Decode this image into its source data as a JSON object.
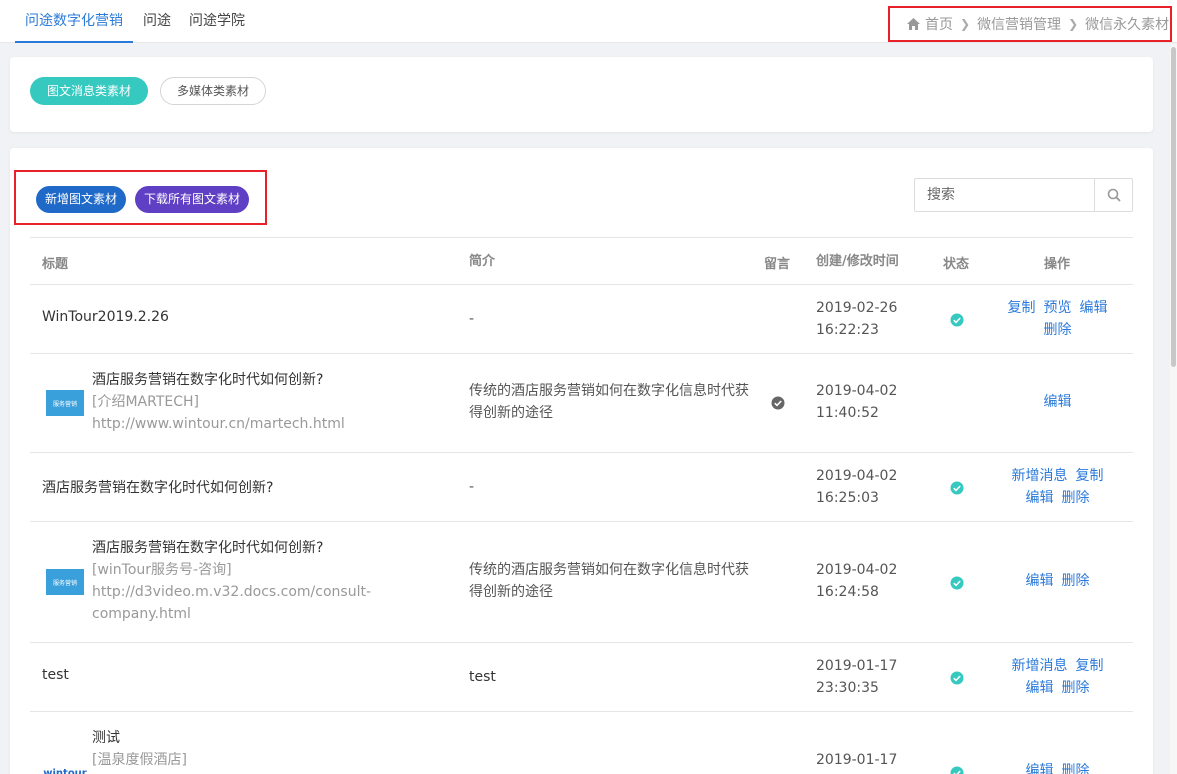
{
  "topnav": {
    "tabs": [
      {
        "label": "问途数字化营销",
        "active": true
      },
      {
        "label": "问途"
      },
      {
        "label": "问途学院"
      }
    ]
  },
  "breadcrumb": {
    "home": "首页",
    "level1": "微信营销管理",
    "level2": "微信永久素材"
  },
  "material_tabs": {
    "news": "图文消息类素材",
    "media": "多媒体类素材"
  },
  "actions": {
    "add": "新增图文素材",
    "download": "下载所有图文素材"
  },
  "search": {
    "placeholder": "搜索"
  },
  "table": {
    "headers": {
      "title": "标题",
      "intro": "简介",
      "comment": "留言",
      "time": "创建/修改时间",
      "status": "状态",
      "ops": "操作"
    },
    "rows": [
      {
        "title": "WinTour2019.2.26",
        "intro": "-",
        "date": "2019-02-26",
        "clock": "16:22:23",
        "ops": [
          "复制",
          "预览",
          "编辑",
          "删除"
        ]
      },
      {
        "title": "酒店服务营销在数字化时代如何创新?",
        "source": "[介绍MARTECH]",
        "link": "http://www.wintour.cn/martech.html",
        "thumb": "服务营销",
        "intro": "传统的酒店服务营销如何在数字化信息时代获得创新的途径",
        "date": "2019-04-02",
        "clock": "11:40:52",
        "ops": [
          "编辑"
        ]
      },
      {
        "title": "酒店服务营销在数字化时代如何创新?",
        "intro": "-",
        "date": "2019-04-02",
        "clock": "16:25:03",
        "ops": [
          "新增消息",
          "复制",
          "编辑",
          "删除"
        ]
      },
      {
        "title": "酒店服务营销在数字化时代如何创新?",
        "source": "[winTour服务号-咨询]",
        "link": "http://d3video.m.v32.docs.com/consult-company.html",
        "thumb": "服务营销",
        "intro": "传统的酒店服务营销如何在数字化信息时代获得创新的途径",
        "date": "2019-04-02",
        "clock": "16:24:58",
        "ops": [
          "编辑",
          "删除"
        ]
      },
      {
        "title": "test",
        "intro": "test",
        "date": "2019-01-17",
        "clock": "23:30:35",
        "ops": [
          "新增消息",
          "复制",
          "编辑",
          "删除"
        ]
      },
      {
        "title": "测试",
        "source": "[温泉度假酒店]",
        "thumb": "wintour",
        "date": "2019-01-17",
        "ops": [
          "编辑",
          "删除"
        ]
      }
    ]
  },
  "colors": {
    "accent": "#2b7ad9",
    "teal": "#35c9c0",
    "blue_btn": "#1f69c8",
    "purple_btn": "#5f3fc4",
    "highlight": "#e8202a",
    "status_ok": "#35c9c0"
  }
}
